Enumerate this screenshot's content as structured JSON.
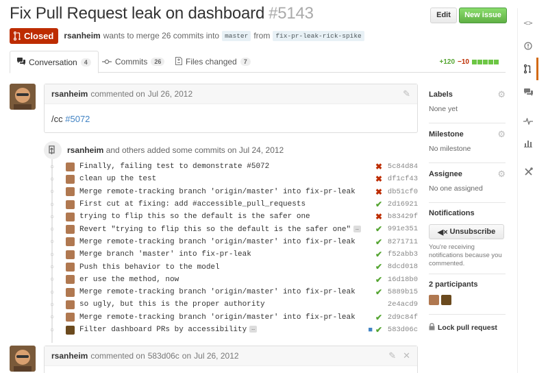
{
  "header": {
    "title": "Fix Pull Request leak on dashboard",
    "number": "#5143",
    "edit_label": "Edit",
    "new_issue_label": "New issue"
  },
  "status": {
    "state_label": "Closed",
    "author": "rsanheim",
    "text_before": "wants to merge 26 commits into",
    "base_branch": "master",
    "text_from": "from",
    "head_branch": "fix-pr-leak-rick-spike"
  },
  "tabs": [
    {
      "label": "Conversation",
      "count": "4",
      "icon": "conversation-icon"
    },
    {
      "label": "Commits",
      "count": "26",
      "icon": "commit-icon"
    },
    {
      "label": "Files changed",
      "count": "7",
      "icon": "file-diff-icon"
    }
  ],
  "diffstat": {
    "additions": "+120",
    "deletions": "−10"
  },
  "comment1": {
    "author": "rsanheim",
    "action": "commented on",
    "date": "Jul 26, 2012",
    "body_prefix": "/cc",
    "body_link": "#5072"
  },
  "commit_summary": {
    "author": "rsanheim",
    "text": "and others added some commits on",
    "date": "Jul 24, 2012"
  },
  "commits": [
    {
      "message": "Finally, failing test to demonstrate #5072",
      "sha": "5c84d84",
      "status": "fail",
      "avatar": "#b07850"
    },
    {
      "message": "clean up the test",
      "sha": "df1cf43",
      "status": "fail",
      "avatar": "#b07850"
    },
    {
      "message": "Merge remote-tracking branch 'origin/master' into fix-pr-leak",
      "sha": "db51cf0",
      "status": "fail",
      "avatar": "#b07850"
    },
    {
      "message": "First cut at fixing: add #accessible_pull_requests",
      "sha": "2d16921",
      "status": "ok",
      "avatar": "#b07850"
    },
    {
      "message": "trying to flip this so the default is the safer one",
      "sha": "b83429f",
      "status": "fail",
      "avatar": "#b07850"
    },
    {
      "message": "Revert \"trying to flip this so the default is the safer one\"",
      "sha": "991e351",
      "status": "ok",
      "avatar": "#b07850",
      "ellipsis": "…"
    },
    {
      "message": "Merge remote-tracking branch 'origin/master' into fix-pr-leak",
      "sha": "8271711",
      "status": "ok",
      "avatar": "#b07850"
    },
    {
      "message": "Merge branch 'master' into fix-pr-leak",
      "sha": "f52abb3",
      "status": "ok",
      "avatar": "#b07850"
    },
    {
      "message": "Push this behavior to the model",
      "sha": "8dcd018",
      "status": "ok",
      "avatar": "#b07850"
    },
    {
      "message": "er use the method, now",
      "sha": "16d18b0",
      "status": "ok",
      "avatar": "#b07850"
    },
    {
      "message": "Merge remote-tracking branch 'origin/master' into fix-pr-leak",
      "sha": "5889b15",
      "status": "ok",
      "avatar": "#b07850"
    },
    {
      "message": "so ugly, but this is the proper authority",
      "sha": "2e4acd9",
      "status": "none",
      "avatar": "#b07850"
    },
    {
      "message": "Merge remote-tracking branch 'origin/master' into fix-pr-leak",
      "sha": "2d9c84f",
      "status": "ok",
      "avatar": "#b07850"
    },
    {
      "message": "Filter dashboard PRs by accessibility",
      "sha": "583d06c",
      "status": "ok",
      "avatar": "#6b4a1e",
      "ellipsis": "…",
      "comment": true
    }
  ],
  "comment2": {
    "author": "rsanheim",
    "action": "commented on",
    "sha": "583d06c",
    "on": "on",
    "date": "Jul 26, 2012"
  },
  "sidebar": {
    "labels_title": "Labels",
    "labels_value": "None yet",
    "milestone_title": "Milestone",
    "milestone_value": "No milestone",
    "assignee_title": "Assignee",
    "assignee_value": "No one assigned",
    "notifications_title": "Notifications",
    "unsubscribe_label": "Unsubscribe",
    "notifications_note": "You're receiving notifications because you commented.",
    "participants_title": "2 participants",
    "lock_label": "Lock pull request"
  },
  "colors": {
    "closed": "#bd2c00",
    "success": "#55a532",
    "link": "#4183c4",
    "accent_rail": "#d26911"
  }
}
